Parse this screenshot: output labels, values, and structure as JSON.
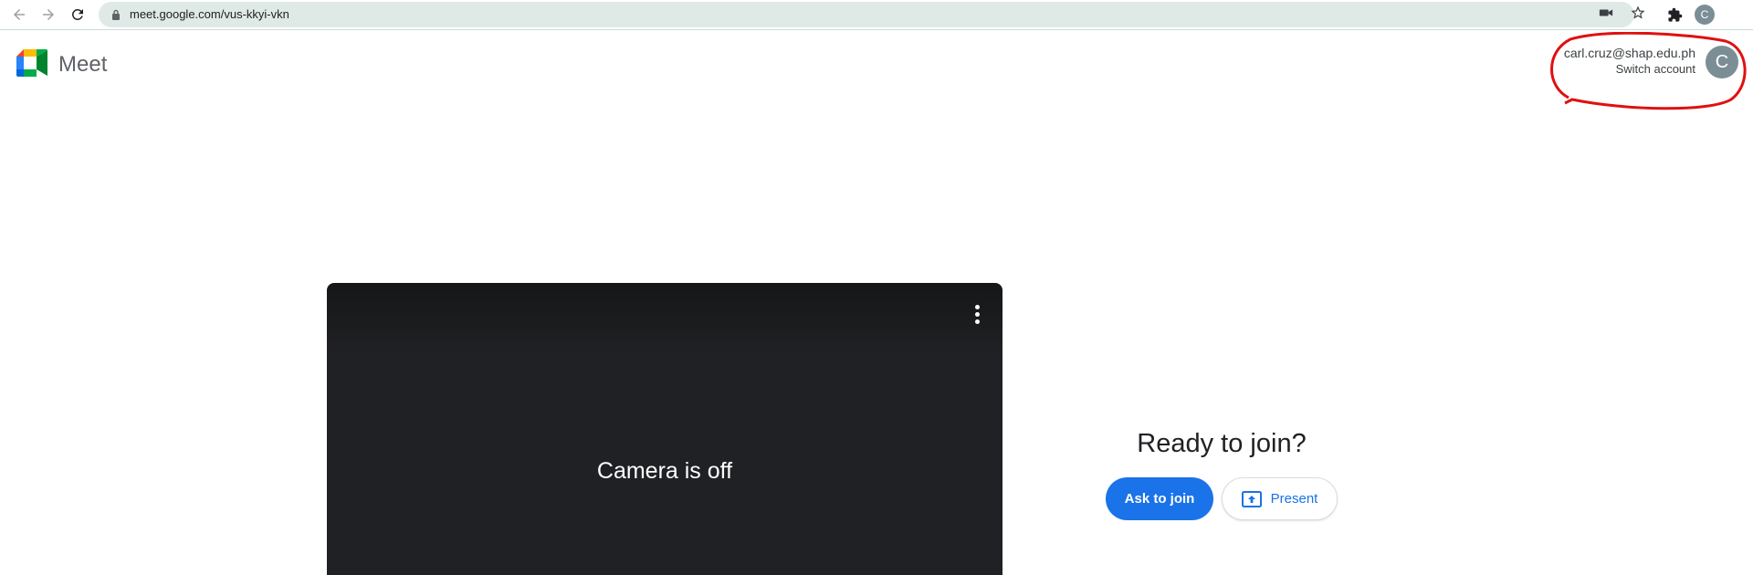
{
  "browser": {
    "url": "meet.google.com/vus-kkyi-vkn",
    "profile_initial": "C"
  },
  "header": {
    "app_name": "Meet",
    "account_email": "carl.cruz@shap.edu.ph",
    "switch_account_label": "Switch account",
    "avatar_initial": "C"
  },
  "preview": {
    "camera_status": "Camera is off"
  },
  "join_panel": {
    "title": "Ready to join?",
    "ask_to_join_label": "Ask to join",
    "present_label": "Present"
  },
  "colors": {
    "primary_blue": "#1a73e8",
    "preview_bg": "#202124",
    "annotation_red": "#e01010",
    "avatar_bg": "#7b8e95"
  },
  "icons": [
    "back-icon",
    "forward-icon",
    "reload-icon",
    "lock-icon",
    "camera-icon",
    "star-icon",
    "puzzle-icon",
    "more-vert-icon",
    "present-screen-icon",
    "meet-logo"
  ]
}
